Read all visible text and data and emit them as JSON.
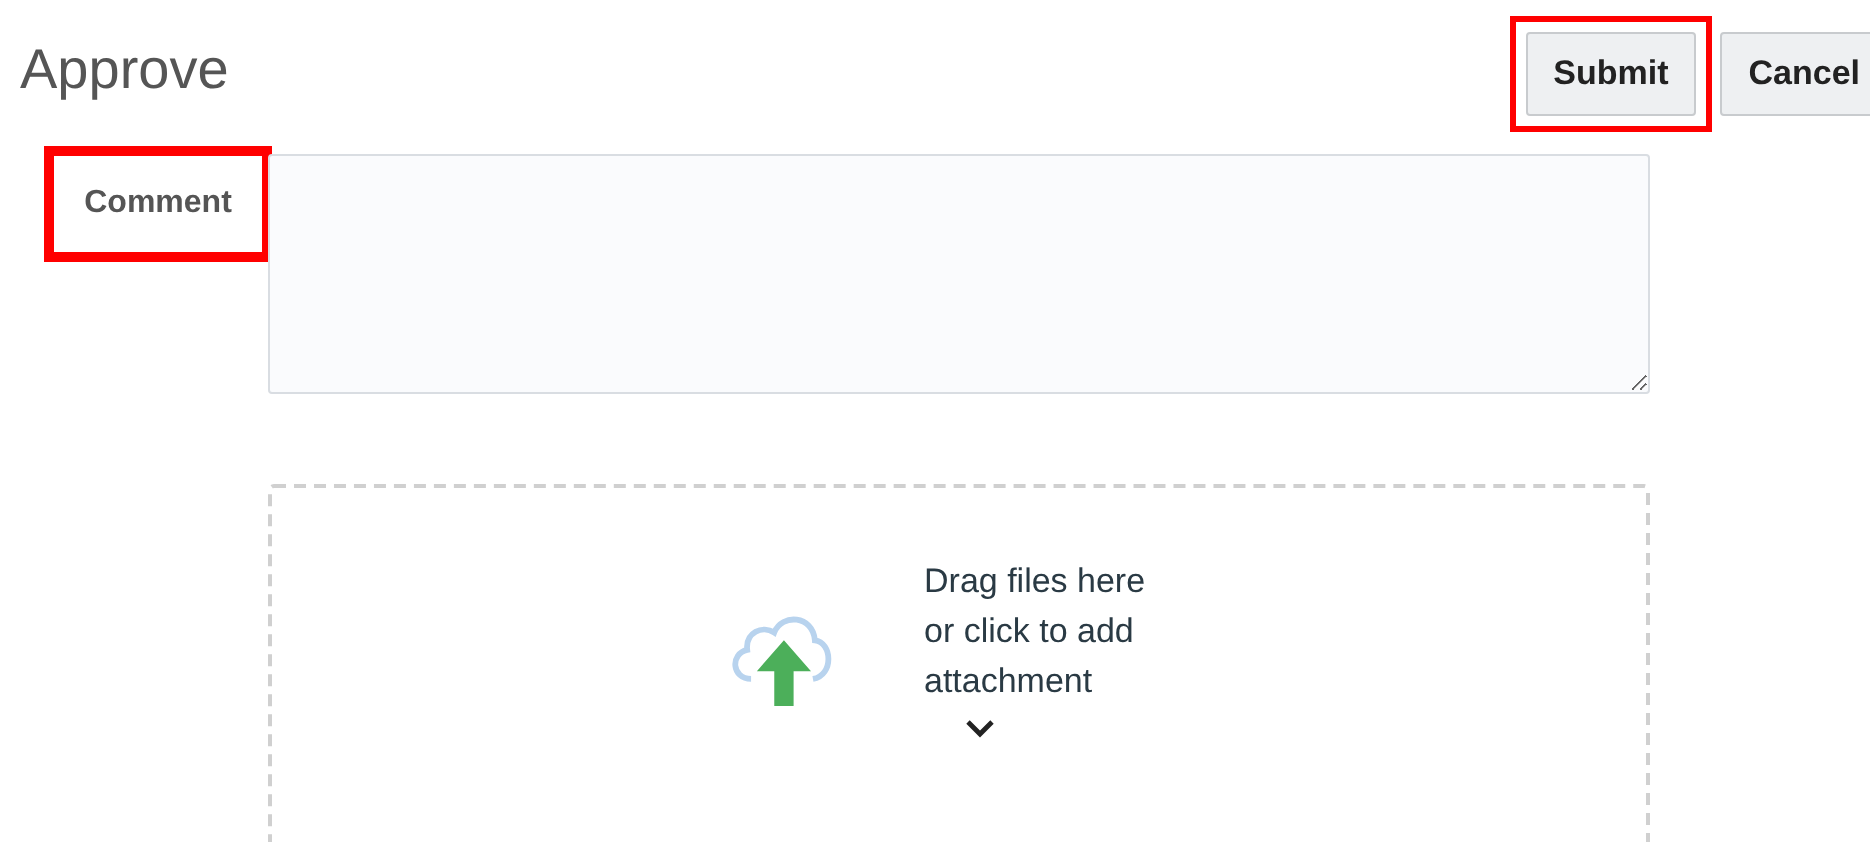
{
  "title": "Approve",
  "buttons": [
    {
      "label": "Submit",
      "highlighted": true
    },
    {
      "label": "Cancel",
      "highlighted": false
    }
  ],
  "comment": {
    "label": "Comment",
    "highlighted": true
  },
  "dropzone": {
    "text": "Drag files here or click to add attachment"
  }
}
